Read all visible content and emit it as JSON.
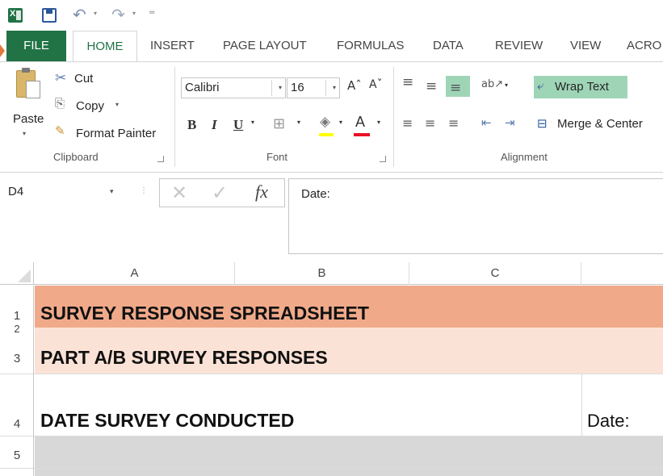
{
  "quick_access": {
    "app_icon": "excel-logo-icon",
    "save_icon": "save-icon",
    "undo_icon": "undo-icon",
    "redo_icon": "redo-icon",
    "undo_glyph": "↶",
    "redo_glyph": "↷",
    "dropdown_glyph": "▾",
    "customize_glyph": "="
  },
  "ribbon_tabs": [
    "FILE",
    "HOME",
    "INSERT",
    "PAGE LAYOUT",
    "FORMULAS",
    "DATA",
    "REVIEW",
    "VIEW",
    "ACRO"
  ],
  "active_tab": "HOME",
  "clipboard": {
    "paste": "Paste",
    "cut": "Cut",
    "copy": "Copy",
    "format_painter": "Format Painter",
    "label": "Clipboard",
    "cut_glyph": "✂",
    "copy_glyph": "⎘",
    "brush_glyph": "✎"
  },
  "font": {
    "name": "Calibri",
    "size": "16",
    "grow_glyph": "Aˆ",
    "shrink_glyph": "Aˇ",
    "bold": "B",
    "italic": "I",
    "underline": "U",
    "border_glyph": "⊞",
    "fill_glyph": "◈",
    "font_color_glyph": "A",
    "dd": "▾",
    "label": "Font"
  },
  "alignment": {
    "top_glyph": "≡",
    "middle_glyph": "≡",
    "bottom_glyph": "≡",
    "orientation_glyph": "ab↗",
    "left_glyph": "≡",
    "center_glyph": "≡",
    "right_glyph": "≡",
    "outdent_glyph": "⇤",
    "indent_glyph": "⇥",
    "wrap_text": "Wrap Text",
    "merge_center": "Merge & Center",
    "label": "Alignment"
  },
  "formula_bar": {
    "name_box": "D4",
    "cancel_glyph": "✕",
    "enter_glyph": "✓",
    "fx_glyph": "fx",
    "content": "Date:"
  },
  "columns": [
    "A",
    "B",
    "C"
  ],
  "rows": [
    {
      "num": "1",
      "text": "SURVEY RESPONSE SPREADSHEET",
      "fill": "#f0aa8a"
    },
    {
      "num": "2",
      "text": "",
      "fill": "#fbe2d6"
    },
    {
      "num": "3",
      "text": "PART A/B SURVEY RESPONSES",
      "fill": "#fbe2d6"
    },
    {
      "num": "4",
      "text": "DATE SURVEY CONDUCTED",
      "extra": "Date:",
      "fill": "#ffffff"
    },
    {
      "num": "5",
      "text": "",
      "fill": "#d8d8d8"
    }
  ],
  "colors": {
    "excel_green": "#217346",
    "selected_highlight": "#9fd5b7",
    "title_fill": "#f0aa8a",
    "subtitle_fill": "#fbe2d6",
    "row5_fill": "#d8d8d8"
  }
}
